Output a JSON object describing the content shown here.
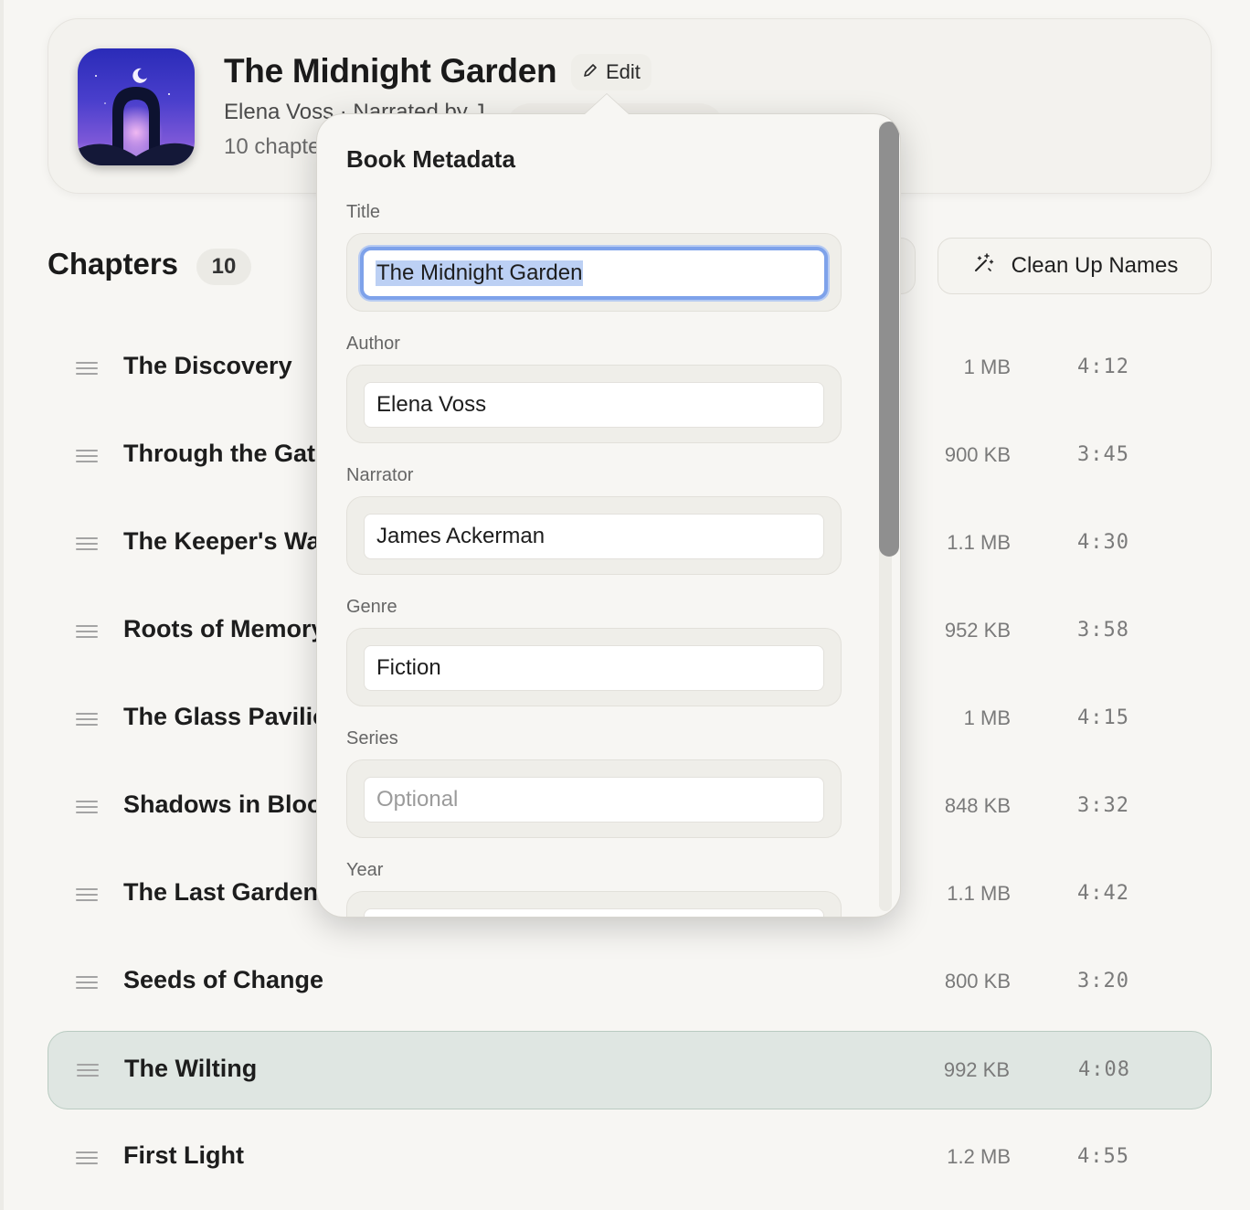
{
  "book": {
    "title": "The Midnight Garden",
    "edit_label": "Edit",
    "byline": "Elena Voss · Narrated by J",
    "summary": "10 chapte"
  },
  "chapters": {
    "heading": "Chapters",
    "count": "10",
    "cleanup_label": "Clean Up Names",
    "items": [
      {
        "name": "The Discovery",
        "size": "1 MB",
        "duration": "4:12"
      },
      {
        "name": "Through the Gate",
        "size": "900 KB",
        "duration": "3:45"
      },
      {
        "name": "The Keeper's Wa",
        "size": "1.1 MB",
        "duration": "4:30"
      },
      {
        "name": "Roots of Memory",
        "size": "952 KB",
        "duration": "3:58"
      },
      {
        "name": "The Glass Pavilio",
        "size": "1 MB",
        "duration": "4:15"
      },
      {
        "name": "Shadows in Bloo",
        "size": "848 KB",
        "duration": "3:32"
      },
      {
        "name": "The Last Gardene",
        "size": "1.1 MB",
        "duration": "4:42"
      },
      {
        "name": "Seeds of Change",
        "size": "800 KB",
        "duration": "3:20"
      },
      {
        "name": "The Wilting",
        "size": "992 KB",
        "duration": "4:08"
      },
      {
        "name": "First Light",
        "size": "1.2 MB",
        "duration": "4:55"
      }
    ]
  },
  "metadata_popover": {
    "title": "Book Metadata",
    "fields": {
      "title": {
        "label": "Title",
        "value": "The Midnight Garden"
      },
      "author": {
        "label": "Author",
        "value": "Elena Voss"
      },
      "narrator": {
        "label": "Narrator",
        "value": "James Ackerman"
      },
      "genre": {
        "label": "Genre",
        "value": "Fiction"
      },
      "series": {
        "label": "Series",
        "value": "",
        "placeholder": "Optional"
      },
      "year": {
        "label": "Year",
        "value": ""
      }
    }
  },
  "colors": {
    "selected_row": "#dfe6e2",
    "focus_ring": "#7ea2ea",
    "text_selection": "#bcd0f4"
  },
  "icons": {
    "edit": "pencil-icon",
    "cleanup": "magic-wand-icon",
    "drag": "drag-handle-icon",
    "cover": "book-cover-art"
  }
}
